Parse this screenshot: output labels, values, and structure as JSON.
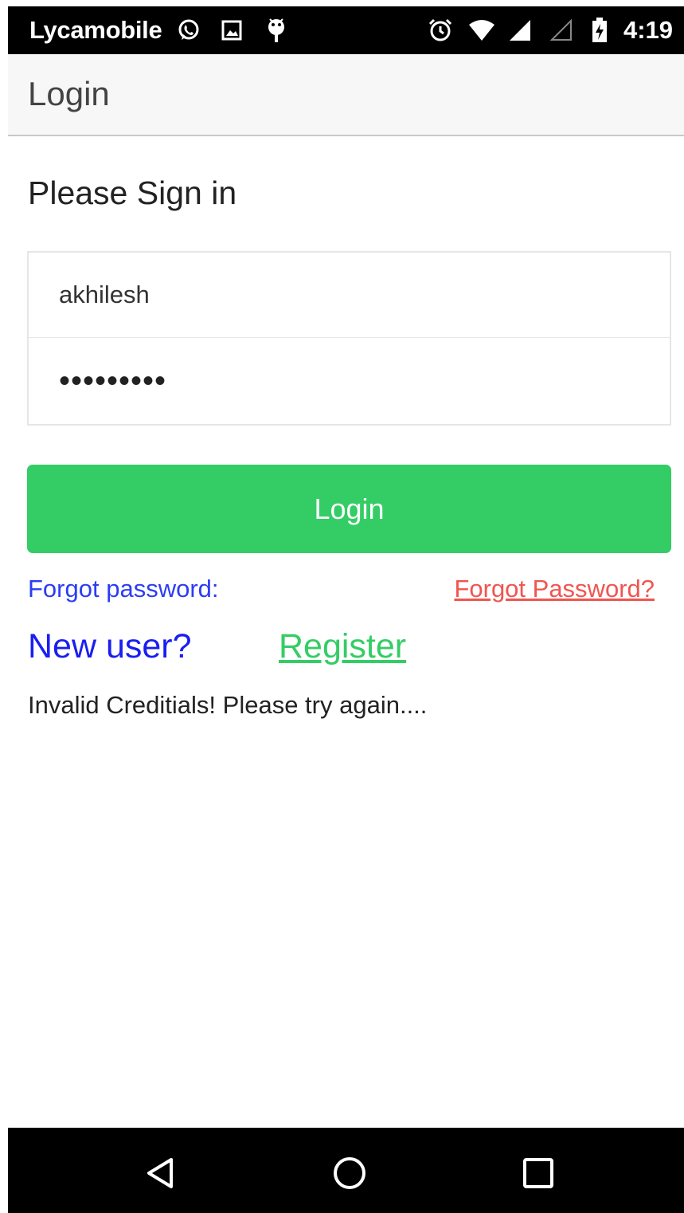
{
  "status_bar": {
    "carrier": "Lycamobile",
    "time": "4:19",
    "icons": [
      "whatsapp-icon",
      "image-icon",
      "android-debug-icon",
      "alarm-icon",
      "wifi-icon",
      "signal-icon",
      "signal-empty-icon",
      "battery-charging-icon"
    ]
  },
  "header": {
    "title": "Login"
  },
  "form": {
    "heading": "Please Sign in",
    "username_value": "akhilesh",
    "password_value": "•••••••••",
    "login_label": "Login"
  },
  "links": {
    "forgot_label": "Forgot password:",
    "forgot_link": "Forgot Password?",
    "new_user_label": "New user?",
    "register_link": "Register"
  },
  "message": {
    "error": "Invalid Creditials! Please try again...."
  },
  "nav_bar": {
    "icons": [
      "back-icon",
      "home-icon",
      "recents-icon"
    ]
  },
  "colors": {
    "accent_green": "#34cd65",
    "link_blue": "#2c3cf5",
    "link_red": "#f05550",
    "header_bg": "#f7f7f7"
  }
}
